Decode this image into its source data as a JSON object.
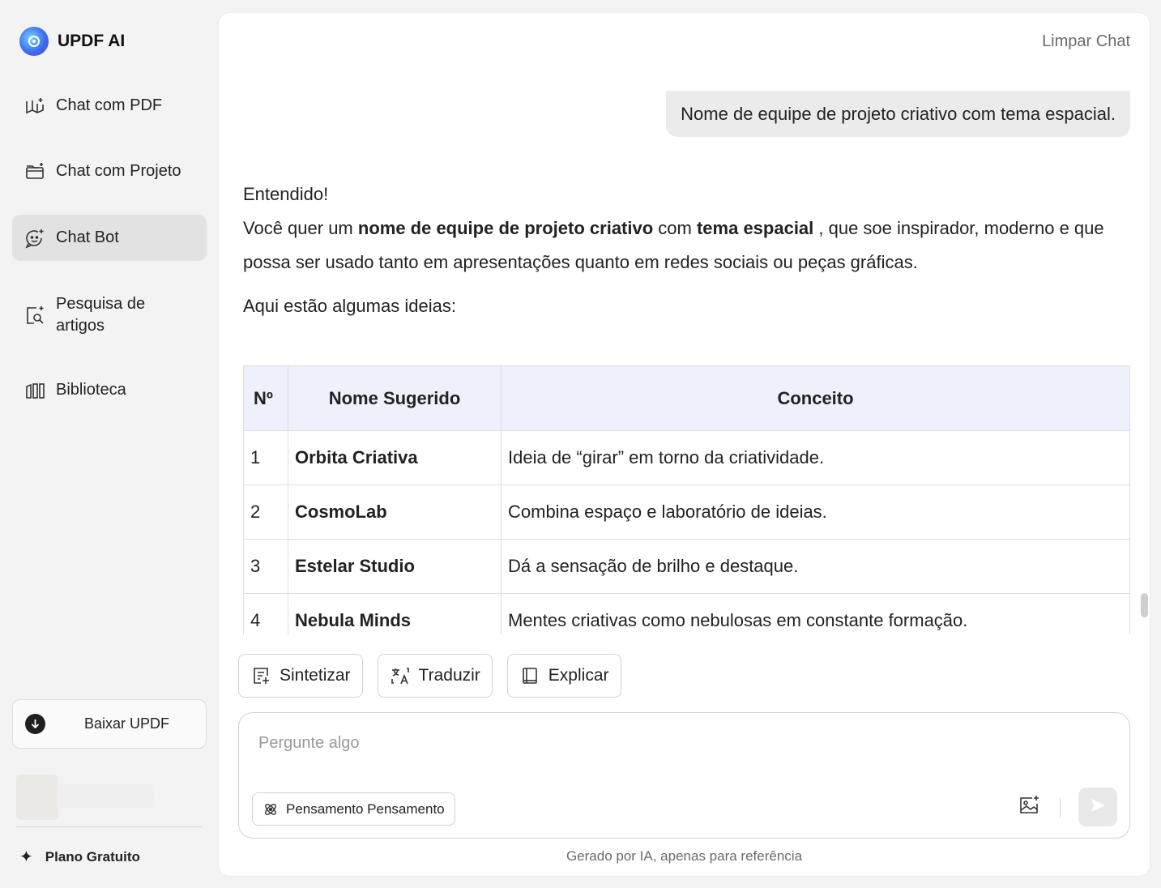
{
  "brand": {
    "title": "UPDF AI"
  },
  "sidebar": {
    "items": [
      {
        "label": "Chat com PDF",
        "icon": "book-ai-icon"
      },
      {
        "label": "Chat com Projeto",
        "icon": "folder-ai-icon"
      },
      {
        "label": "Chat Bot",
        "icon": "chat-bot-icon",
        "active": true
      },
      {
        "label": "Pesquisa de artigos",
        "icon": "article-search-icon"
      },
      {
        "label": "Biblioteca",
        "icon": "library-icon"
      }
    ],
    "download_label": "Baixar UPDF",
    "plan_label": "Plano Gratuito"
  },
  "header": {
    "clear_chat": "Limpar Chat"
  },
  "chat": {
    "user_message": "Nome de equipe de projeto criativo com tema espacial.",
    "answer": {
      "line1": "Entendido!",
      "p_before": "Você quer um ",
      "p_bold1": "nome de equipe de projeto criativo",
      "p_mid": " com ",
      "p_bold2": "tema espacial",
      "p_after": " , que soe inspirador, moderno e que possa ser usado tanto em apresentações quanto em redes sociais ou peças gráficas.",
      "ideas": "Aqui estão algumas ideias:"
    },
    "table": {
      "headers": [
        "Nº",
        "Nome Sugerido",
        "Conceito"
      ],
      "rows": [
        [
          "1",
          "Orbita Criativa",
          "Ideia de “girar” em torno da criatividade."
        ],
        [
          "2",
          "CosmoLab",
          "Combina espaço e laboratório de ideias."
        ],
        [
          "3",
          "Estelar Studio",
          "Dá a sensação de brilho e destaque."
        ],
        [
          "4",
          "Nebula Minds",
          "Mentes criativas como nebulosas em constante formação."
        ]
      ]
    }
  },
  "actions": [
    {
      "label": "Sintetizar",
      "icon": "summarize-icon"
    },
    {
      "label": "Traduzir",
      "icon": "translate-icon"
    },
    {
      "label": "Explicar",
      "icon": "explain-book-icon"
    }
  ],
  "input": {
    "placeholder": "Pergunte algo",
    "value": "",
    "thinking_label": "Pensamento Pensamento"
  },
  "footer": {
    "disclaimer": "Gerado por IA, apenas para referência"
  }
}
